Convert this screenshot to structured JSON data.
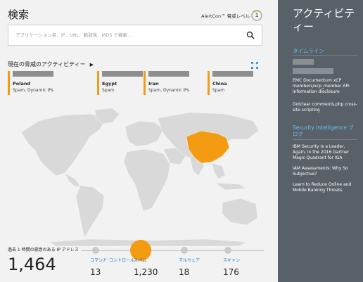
{
  "search": {
    "title": "検索",
    "placeholder": "アプリケーション名、IP、URL、脆弱性、MD5 で検索..."
  },
  "alertcon": {
    "label": "AlertCon™ 脅威レベル",
    "level": "1"
  },
  "threats": {
    "heading": "現在の脅威のアクティビティー",
    "cards": [
      {
        "country": "Poland",
        "type": "Spam, Dynamic IPs"
      },
      {
        "country": "Egypt",
        "type": "Spam"
      },
      {
        "country": "Iran",
        "type": "Spam, Dynamic IPs"
      },
      {
        "country": "China",
        "type": "Spam"
      }
    ]
  },
  "stats": {
    "ip_label": "過去 1 時間の悪意のある IP アドレス",
    "total": "1,464",
    "items": [
      {
        "label": "コマンド･コントロール",
        "value": "13"
      },
      {
        "label": "スパム",
        "value": "1,230"
      },
      {
        "label": "マルウェア",
        "value": "18"
      },
      {
        "label": "スキャン",
        "value": "176"
      }
    ]
  },
  "sidebar": {
    "title": "アクティビティー",
    "timeline_label": "タイムライン",
    "timeline_items": [
      "EMC Documentum xCP members/xcp_member API information disclosure",
      "Dotclear comments.php cross-site scripting"
    ],
    "blog_label": "Security Intelligence ブログ",
    "blog_items": [
      "IBM Security Is a Leader, Again, in the 2016 Gartner Magic Quadrant for IGA",
      "IAM Assessments: Why So Subjective?",
      "Learn to Reduce Online and Mobile Banking Threats"
    ]
  },
  "colors": {
    "accent": "#f39c12",
    "sidebar_bg": "#5a6068",
    "link": "#5ec5f5"
  }
}
